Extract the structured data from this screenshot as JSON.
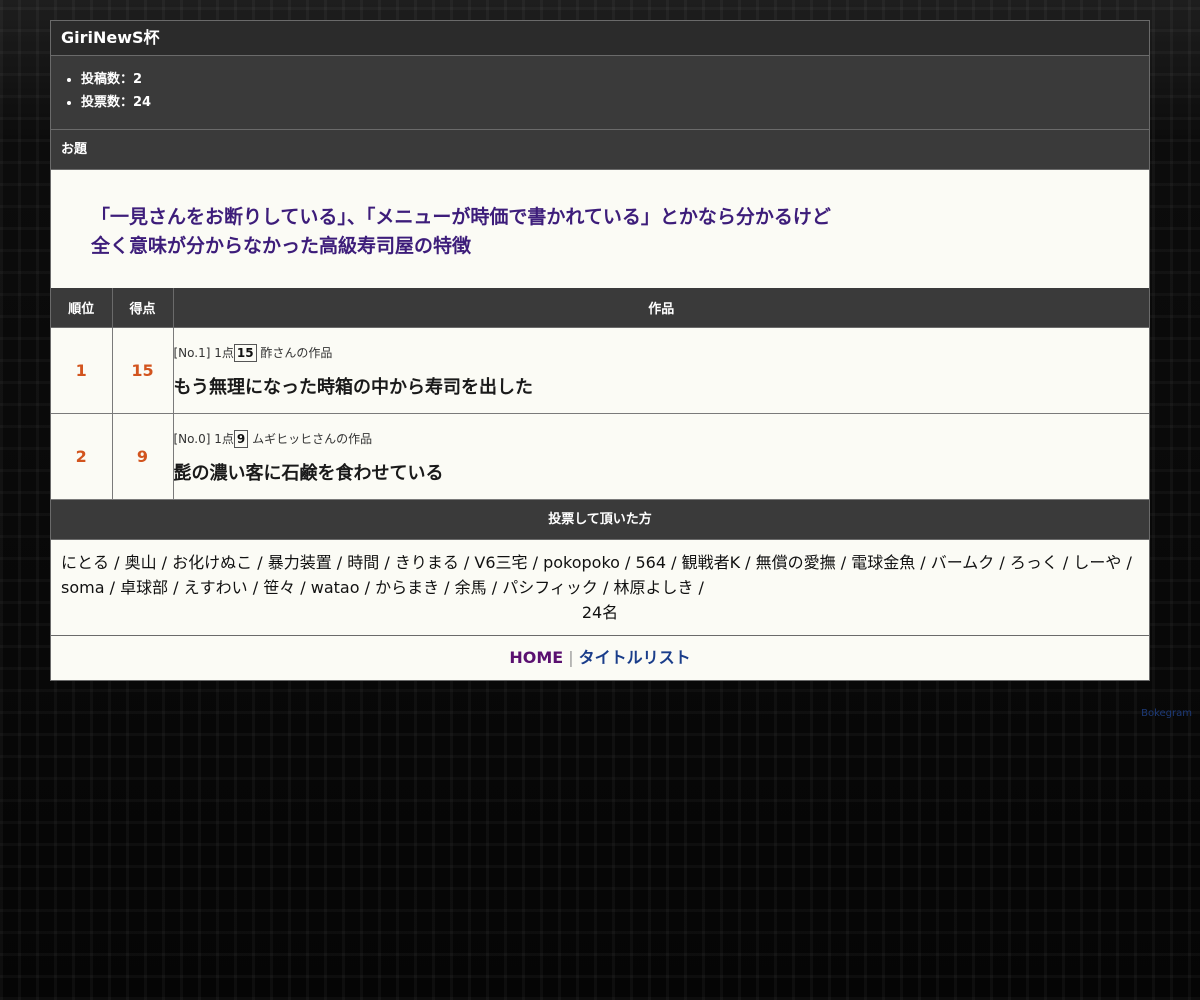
{
  "header": {
    "title": "GiriNewS杯"
  },
  "stats": {
    "posts": "投稿数：2",
    "votes": "投票数：24"
  },
  "odai": {
    "label": "お題",
    "lines": [
      "「一見さんをお断りしている」、「メニューが時価で書かれている」とかなら分かるけど",
      "全く意味が分からなかった高級寿司屋の特徴"
    ]
  },
  "table": {
    "headers": {
      "rank": "順位",
      "score": "得点",
      "work": "作品"
    },
    "rows": [
      {
        "rank": "1",
        "score": "15",
        "meta_prefix": "[No.1] 1点",
        "votes": "15",
        "author": "酢さんの作品",
        "text": "もう無理になった時箱の中から寿司を出した"
      },
      {
        "rank": "2",
        "score": "9",
        "meta_prefix": "[No.0] 1点",
        "votes": "9",
        "author": "ムギヒッヒさんの作品",
        "text": "髭の濃い客に石鹸を食わせている"
      }
    ]
  },
  "voters": {
    "label": "投票して頂いた方",
    "list": "にとる / 奥山 / お化けぬこ / 暴力装置 / 時間 / きりまる / V6三宅 / pokopoko / 564 / 観戦者K / 無償の愛撫 / 電球金魚 / バームク / ろっく / しーや / soma / 卓球部 / えすわい / 笹々 / watao / からまき / 余馬 / パシフィック / 林原よしき /",
    "count": "24名"
  },
  "footer": {
    "home": "HOME",
    "separator": "|",
    "titles": "タイトルリスト"
  },
  "credit": "Bokegram",
  "colors": {
    "rank_score": "#d2541e",
    "odai_text": "#3d1d7a",
    "home_link": "#5a1070",
    "title_link": "#1a3d8a"
  }
}
